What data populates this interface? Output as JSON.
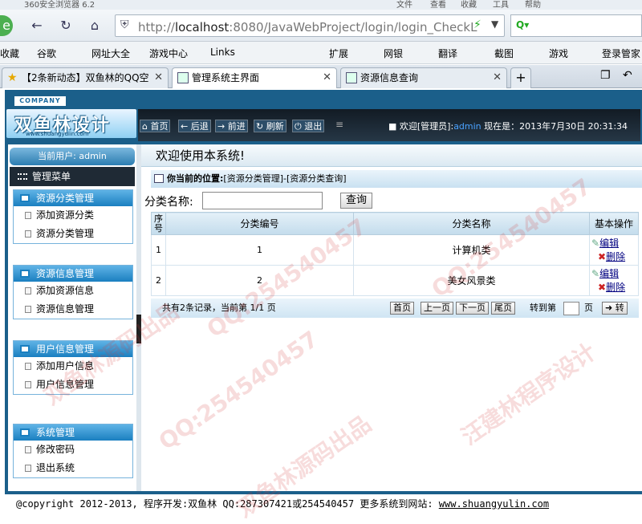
{
  "browser": {
    "title": "360安全浏览器 6.2",
    "menu_items": [
      "文件",
      "查看",
      "收藏",
      "工具",
      "帮助"
    ],
    "url_host": "localhost",
    "url_rest": ":8080/JavaWebProject/login/login_CheckL",
    "bookmarks": [
      "收藏",
      "谷歌",
      "网址大全",
      "游戏中心",
      "Links",
      "扩展",
      "网银",
      "翻译",
      "截图",
      "游戏",
      "登录管家"
    ],
    "tabs": [
      {
        "label": "【2条新动态】双鱼林的QQ空",
        "active": false
      },
      {
        "label": "管理系统主界面",
        "active": true
      },
      {
        "label": "资源信息查询",
        "active": false
      }
    ]
  },
  "app": {
    "company": "COMPANY",
    "logo_text": "双鱼林设计",
    "logo_url": "www.shuangyulin.com",
    "toolbar": [
      "首页",
      "后退",
      "前进",
      "刷新",
      "退出"
    ],
    "welcome_prefix": "欢迎[管理员]:",
    "welcome_user": "admin",
    "now_label": "现在是：",
    "now_value": "2013年7月30日 20:31:34",
    "current_user": "当前用户: admin",
    "menu_title": "管理菜单",
    "groups": [
      {
        "title": "资源分类管理",
        "items": [
          "添加资源分类",
          "资源分类管理"
        ]
      },
      {
        "title": "资源信息管理",
        "items": [
          "添加资源信息",
          "资源信息管理"
        ]
      },
      {
        "title": "用户信息管理",
        "items": [
          "添加用户信息",
          "用户信息管理"
        ]
      },
      {
        "title": "系统管理",
        "items": [
          "修改密码",
          "退出系统"
        ]
      }
    ],
    "main_title": "欢迎使用本系统!",
    "position_label": "你当前的位置:",
    "position_path": "[资源分类管理]-[资源分类查询]",
    "search_label": "分类名称:",
    "search_value": "",
    "search_button": "查询",
    "table": {
      "headers": [
        "序号",
        "分类编号",
        "分类名称",
        "基本操作"
      ],
      "rows": [
        {
          "index": "1",
          "code": "1",
          "name": "计算机类",
          "edit": "编辑",
          "del": "删除"
        },
        {
          "index": "2",
          "code": "2",
          "name": "美女风景类",
          "edit": "编辑",
          "del": "删除"
        }
      ]
    },
    "pager": {
      "summary": "共有2条记录，当前第 1/1 页",
      "first": "首页",
      "prev": "上一页",
      "next": "下一页",
      "last": "尾页",
      "goto_label": "转到第",
      "page_value": "",
      "page_suffix": "页",
      "go": "转"
    },
    "footer": {
      "copyright": "@copyright 2012-2013, 程序开发:双鱼林  QQ:287307421或254540457   更多系统到网站:",
      "site": "www.shuangyulin.com"
    },
    "watermarks": [
      "QQ:254540457",
      "汪建林程序设计",
      "双鱼林源码出品"
    ]
  },
  "colors": {
    "frame": "#1b5f8a",
    "menu_group": "#1a7fc0",
    "link": "#000080"
  }
}
